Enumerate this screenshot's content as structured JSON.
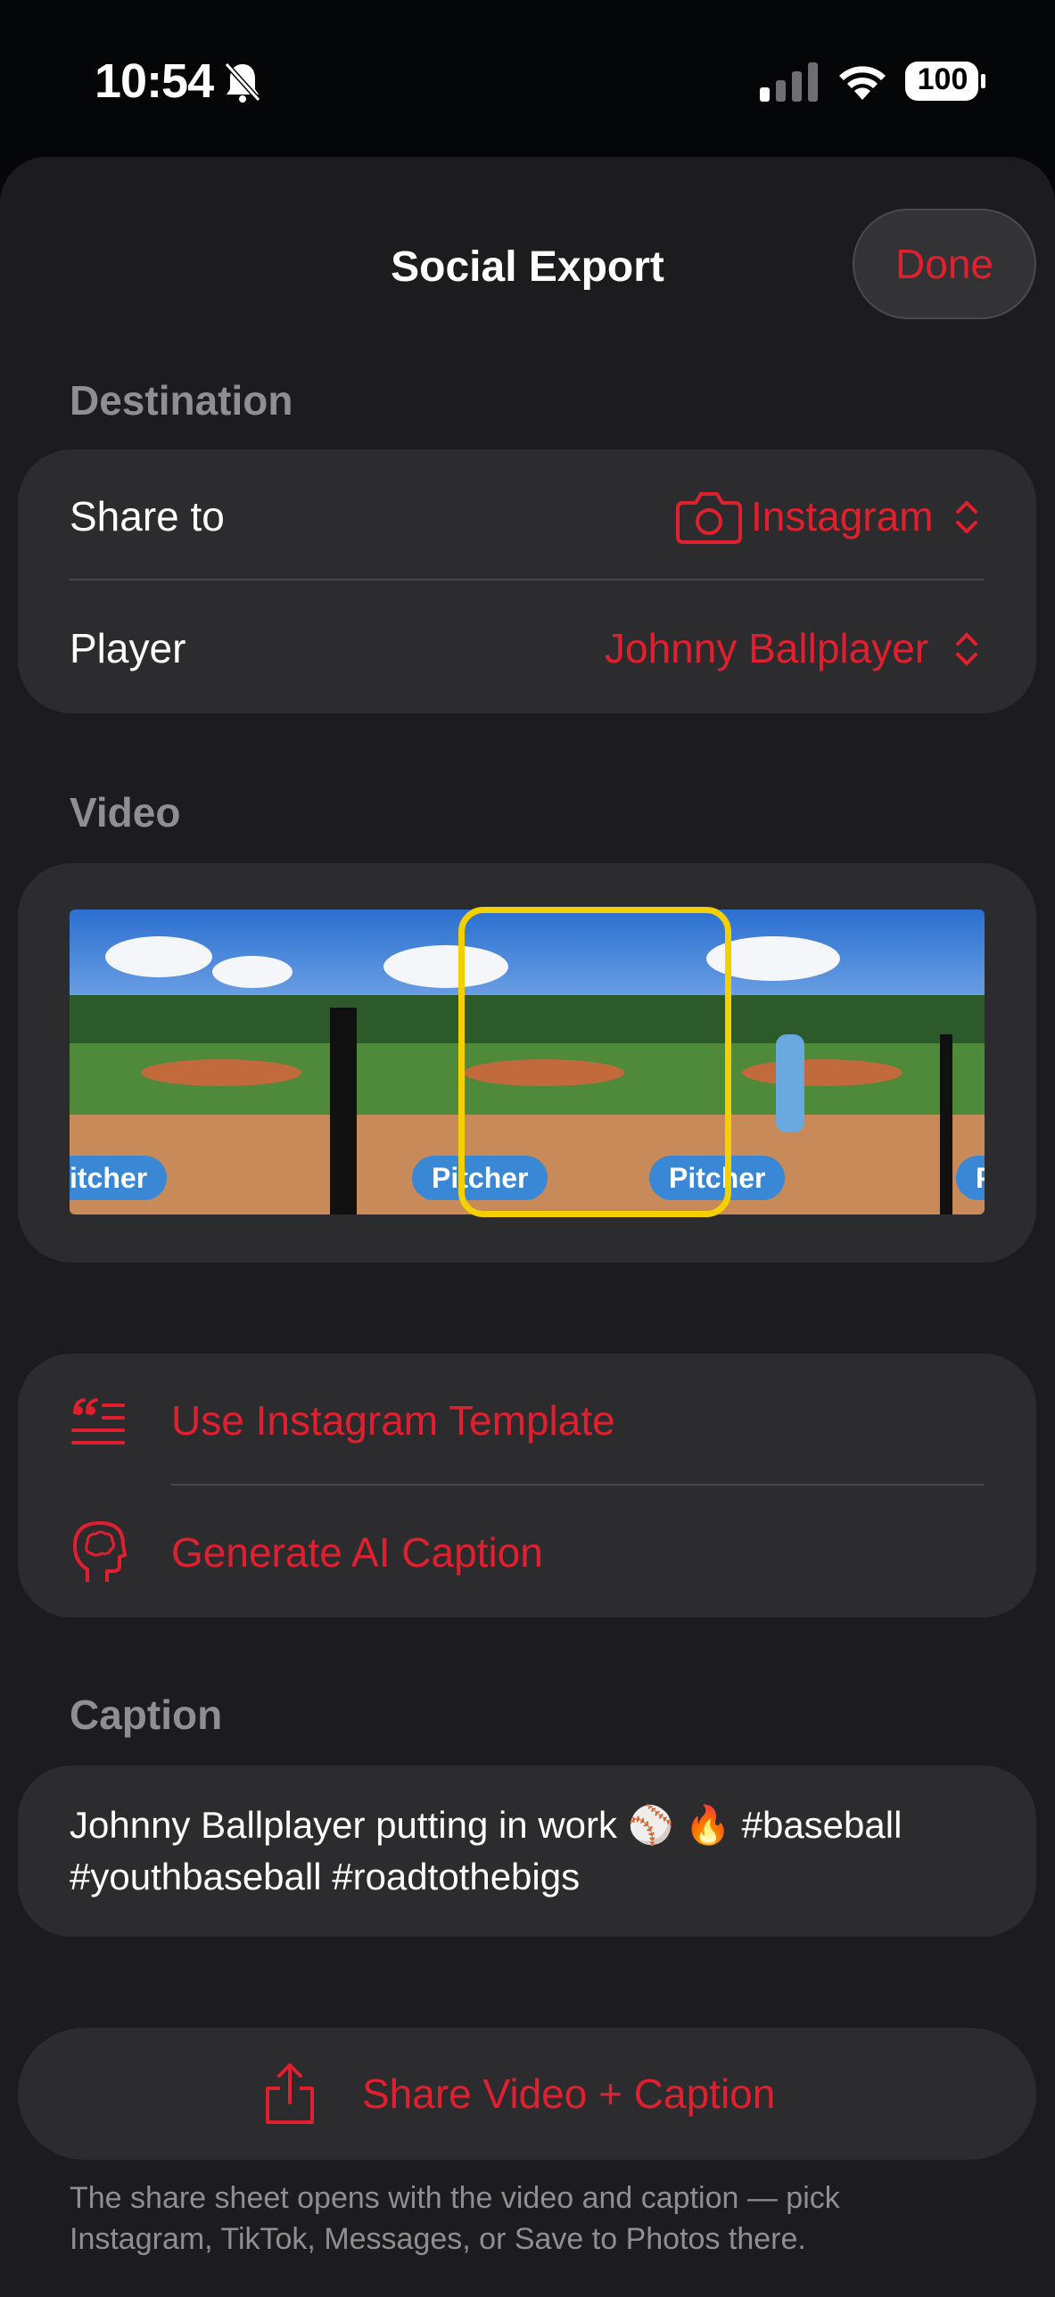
{
  "status_bar": {
    "time": "10:54",
    "battery": "100",
    "icons": [
      "bell-slash-icon",
      "cellular-signal-icon",
      "wifi-icon",
      "battery-icon"
    ]
  },
  "nav": {
    "title": "Social Export",
    "done_label": "Done"
  },
  "destination": {
    "header": "Destination",
    "share_to_label": "Share to",
    "share_to_value": "Instagram",
    "share_to_icon": "camera-icon",
    "player_label": "Player",
    "player_value": "Johnny Ballplayer"
  },
  "video": {
    "header": "Video",
    "frames": [
      {
        "tag": "itcher"
      },
      {
        "tag": "Pitcher"
      },
      {
        "tag": "Pitcher"
      },
      {
        "tag": "P"
      }
    ]
  },
  "actions": {
    "template_label": "Use Instagram Template",
    "template_icon": "text-quote-icon",
    "ai_caption_label": "Generate AI Caption",
    "ai_caption_icon": "brain-head-icon"
  },
  "caption": {
    "header": "Caption",
    "line1": "Johnny Ballplayer putting in work ⚾️ 🔥 #baseball",
    "line2": "#youthbaseball #roadtothebigs"
  },
  "share": {
    "label": "Share Video + Caption",
    "icon": "share-icon",
    "footnote_line1": "The share sheet opens with the video and caption — pick",
    "footnote_line2": "Instagram, TikTok, Messages, or Save to Photos there."
  },
  "colors": {
    "accent": "#e0202e",
    "background": "#1c1c1e",
    "card": "#2c2c2e",
    "selection": "#f4d000",
    "tag": "#3a87d6"
  }
}
